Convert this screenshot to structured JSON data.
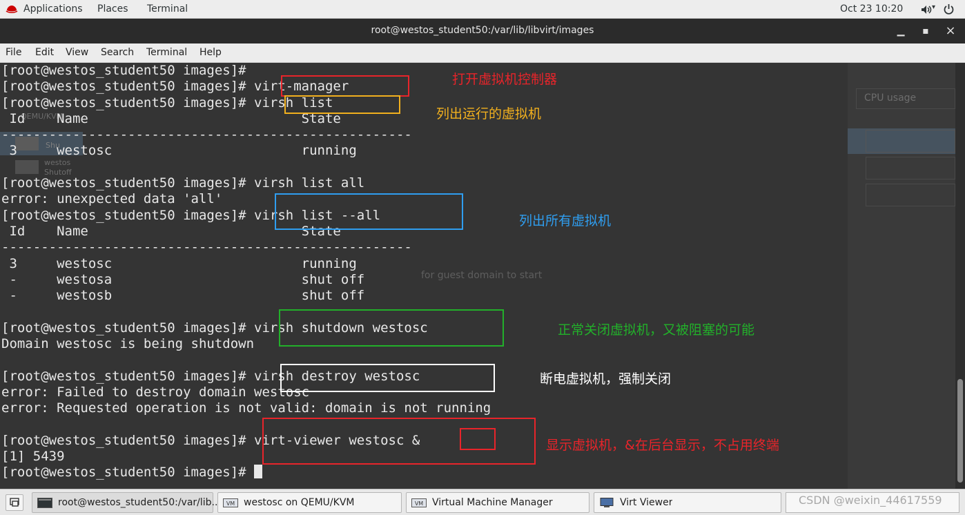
{
  "top_panel": {
    "applications": "Applications",
    "places": "Places",
    "terminal": "Terminal",
    "clock": "Oct 23  10:20",
    "icons": [
      "redhat-icon",
      "sound-icon",
      "power-icon"
    ]
  },
  "window": {
    "title": "root@westos_student50:/var/lib/libvirt/images",
    "menu": [
      "File",
      "Edit",
      "View",
      "Search",
      "Terminal",
      "Help"
    ]
  },
  "terminal": {
    "lines": [
      "[root@westos_student50 images]#",
      "[root@westos_student50 images]# virt-manager",
      "[root@westos_student50 images]# virsh list",
      " Id    Name                           State",
      "----------------------------------------------------",
      " 3     westosc                        running",
      "",
      "[root@westos_student50 images]# virsh list all",
      "error: unexpected data 'all'",
      "[root@westos_student50 images]# virsh list --all",
      " Id    Name                           State",
      "----------------------------------------------------",
      " 3     westosc                        running",
      " -     westosa                        shut off",
      " -     westosb                        shut off",
      "",
      "[root@westos_student50 images]# virsh shutdown westosc",
      "Domain westosc is being shutdown",
      "",
      "[root@westos_student50 images]# virsh destroy westosc",
      "error: Failed to destroy domain westosc",
      "error: Requested operation is not valid: domain is not running",
      "",
      "[root@westos_student50 images]# virt-viewer westosc &",
      "[1] 5439",
      "[root@westos_student50 images]# "
    ]
  },
  "background_window": {
    "cpu_usage": "CPU usage",
    "group": "QEMU/KVM",
    "vm1": "westos",
    "vm1_state": "Shutoff",
    "vm0_state": "Shu",
    "waiting": "for guest domain to start"
  },
  "annotations": [
    {
      "text": "打开虚拟机控制器",
      "color": "#e8242a"
    },
    {
      "text": "列出运行的虚拟机",
      "color": "#f2b01e"
    },
    {
      "text": "列出所有虚拟机",
      "color": "#2f9ef0"
    },
    {
      "text": "正常关闭虚拟机，又被阻塞的可能",
      "color": "#22b02a"
    },
    {
      "text": "断电虚拟机，强制关闭",
      "color": "#ffffff"
    },
    {
      "text": "显示虚拟机，&在后台显示，不占用终端",
      "color": "#e8242a"
    }
  ],
  "taskbar": {
    "items": [
      {
        "label": "root@westos_student50:/var/lib..."
      },
      {
        "label": "westosc on QEMU/KVM"
      },
      {
        "label": "Virtual Machine Manager"
      },
      {
        "label": "Virt Viewer"
      }
    ],
    "watermark": "CSDN @weixin_44617559"
  }
}
